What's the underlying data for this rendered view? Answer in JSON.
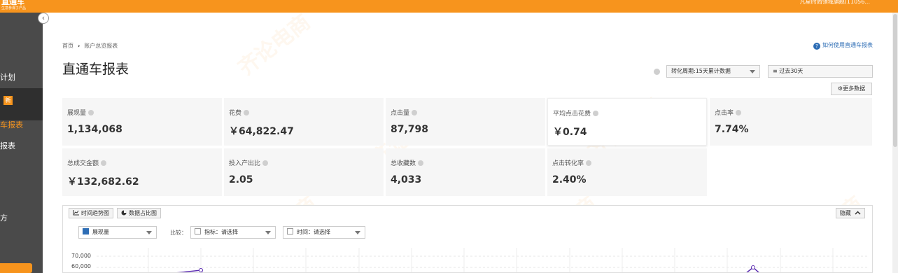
{
  "topbar": {
    "logo_main": "直通车",
    "logo_sub": "生意参谋子产品",
    "info": "凡星时尚领域旗舰(11056..."
  },
  "sidebar": {
    "collapse_icon": "‹",
    "items": [
      "计划",
      "新",
      "车报表",
      "报表",
      "方"
    ]
  },
  "breadcrumb": {
    "home": "首页",
    "sep": "›",
    "current": "账户总览报表"
  },
  "help": {
    "icon": "?",
    "label": "如何使用直通车报表"
  },
  "page_title": "直通车报表",
  "filters": {
    "period": "转化周期:15天累计数据",
    "range_icon": "≡",
    "range": "过去30天",
    "more_icon": "⚙",
    "more": "更多数据"
  },
  "metrics_row1": [
    {
      "label": "展现量",
      "value": "1,134,068"
    },
    {
      "label": "花费",
      "value": "￥64,822.47"
    },
    {
      "label": "点击量",
      "value": "87,798"
    },
    {
      "label": "平均点击花费",
      "value": "￥0.74"
    },
    {
      "label": "点击率",
      "value": "7.74%"
    }
  ],
  "metrics_row2": [
    {
      "label": "总成交金额",
      "value": "￥132,682.62"
    },
    {
      "label": "投入产出比",
      "value": "2.05"
    },
    {
      "label": "总收藏数",
      "value": "4,033"
    },
    {
      "label": "点击转化率",
      "value": "2.40%"
    }
  ],
  "chart_panel": {
    "tab_trend": "时间趋势图",
    "tab_share": "数据占比图",
    "hide": "隐藏",
    "metric_select": "展现量",
    "compare_label": "比较：",
    "indicator_select": "指标：请选择",
    "time_select": "时间：请选择",
    "yticks": [
      "70,000",
      "60,000"
    ]
  },
  "watermark": "齐论电商",
  "colors": {
    "brand": "#f7941d",
    "link": "#2d6db5",
    "line": "#5a2bb0"
  }
}
